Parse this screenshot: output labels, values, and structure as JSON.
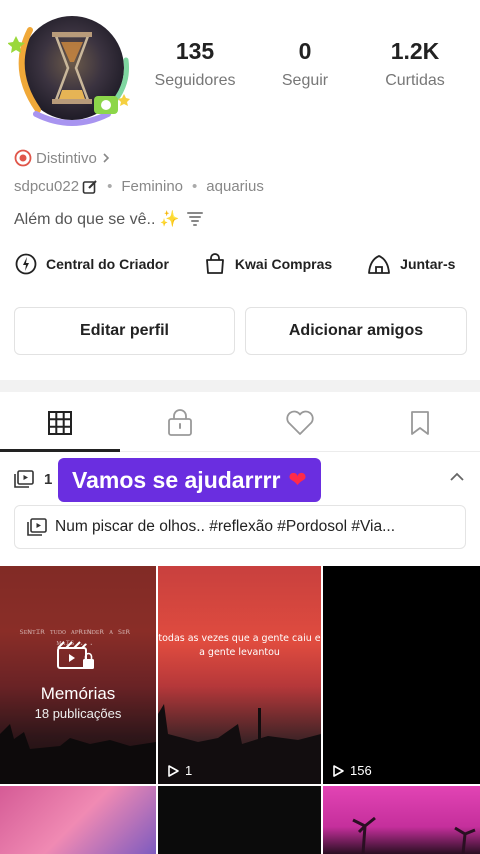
{
  "profile": {
    "username": "sdpcu022",
    "gender": "Feminino",
    "sign": "aquarius",
    "bio": "Além do que se vê.. ✨",
    "badge_label": "Distintivo",
    "stats": [
      {
        "value": "135",
        "label": "Seguidores"
      },
      {
        "value": "0",
        "label": "Seguir"
      },
      {
        "value": "1.2K",
        "label": "Curtidas"
      }
    ]
  },
  "quick_links": [
    {
      "label": "Central do Criador",
      "icon": "lightbulb-icon"
    },
    {
      "label": "Kwai Compras",
      "icon": "shopping-bag-icon"
    },
    {
      "label": "Juntar-s",
      "icon": "tent-icon"
    }
  ],
  "buttons": {
    "edit": "Editar perfil",
    "add_friends": "Adicionar amigos"
  },
  "tabs": [
    {
      "name": "grid",
      "icon": "grid-icon",
      "active": true
    },
    {
      "name": "private",
      "icon": "lock-icon",
      "active": false
    },
    {
      "name": "likes",
      "icon": "heart-icon",
      "active": false
    },
    {
      "name": "saved",
      "icon": "bookmark-icon",
      "active": false
    }
  ],
  "playlist": {
    "count": "1",
    "caption": "Vamos se ajudarrrr",
    "caption_emoji": "❤",
    "item_title": "Num piscar de olhos.. #reflexão #Pordosol #Via..."
  },
  "videos": [
    {
      "type": "collection",
      "title": "Memórias",
      "subtitle": "18 publicações",
      "scribble": "ꜱᴇɴᴛɪʀ ᴛᴜᴅᴏ ᴀᴘʀᴇɴᴅᴇʀ ᴀ ꜱᴇʀ ᴍᴀɪꜱ ..."
    },
    {
      "type": "video",
      "overlay_text": "todas as vezes que a gente caiu e a gente levantou",
      "plays": "1"
    },
    {
      "type": "video",
      "plays": "156"
    },
    {
      "type": "video"
    },
    {
      "type": "video"
    },
    {
      "type": "video"
    }
  ],
  "colors": {
    "caption_bg": "#6a2ee0",
    "accent_heart": "#ff2a4a",
    "badge": "#e0564a"
  }
}
